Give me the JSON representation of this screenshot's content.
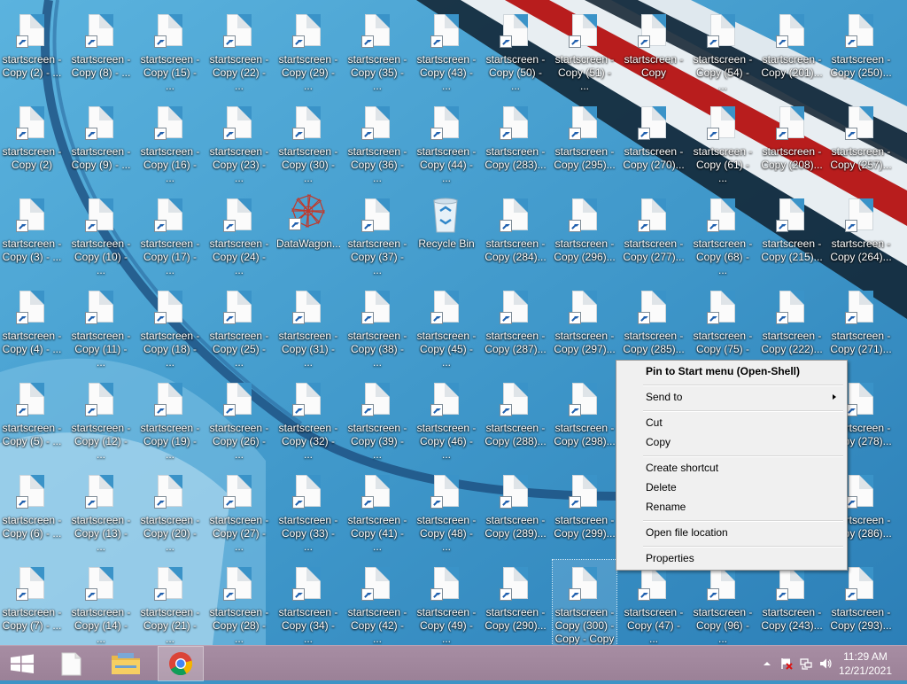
{
  "desktop": {
    "shortcut_label_prefix": "startscreen -",
    "columns": [
      [
        "Copy (2) - ...",
        "Copy (2)",
        "Copy (3) - ...",
        "Copy (4) - ...",
        "Copy (5) - ...",
        "Copy (6) - ...",
        "Copy (7) - ..."
      ],
      [
        "Copy (8) - ...",
        "Copy (9) - ...",
        "Copy (10) - ...",
        "Copy (11) - ...",
        "Copy (12) - ...",
        "Copy (13) - ...",
        "Copy (14) - ..."
      ],
      [
        "Copy (15) - ...",
        "Copy (16) - ...",
        "Copy (17) - ...",
        "Copy (18) - ...",
        "Copy (19) - ...",
        "Copy (20) - ...",
        "Copy (21) - ..."
      ],
      [
        "Copy (22) - ...",
        "Copy (23) - ...",
        "Copy (24) - ...",
        "Copy (25) - ...",
        "Copy (26) - ...",
        "Copy (27) - ...",
        "Copy (28) - ..."
      ],
      [
        "Copy (29) - ...",
        "Copy (30) - ...",
        "DataWagon...",
        "Copy (31) - ...",
        "Copy (32) - ...",
        "Copy (33) - ...",
        "Copy (34) - ..."
      ],
      [
        "Copy (35) - ...",
        "Copy (36) - ...",
        "Copy (37) - ...",
        "Copy (38) - ...",
        "Copy (39) - ...",
        "Copy (41) - ...",
        "Copy (42) - ..."
      ],
      [
        "Copy (43) - ...",
        "Copy (44) - ...",
        "Recycle Bin",
        "Copy (45) - ...",
        "Copy (46) - ...",
        "Copy (48) - ...",
        "Copy (49) - ..."
      ],
      [
        "Copy (50) - ...",
        "Copy (283)...",
        "Copy (284)...",
        "Copy (287)...",
        "Copy (288)...",
        "Copy (289)...",
        "Copy (290)..."
      ],
      [
        "Copy (51) - ...",
        "Copy (295)...",
        "Copy (296)...",
        "Copy (297)...",
        "Copy (298)...",
        "Copy (299)...",
        "Copy (300) - Copy - Copy"
      ],
      [
        "Copy",
        "Copy (270)...",
        "Copy (277)...",
        "Copy (285)...",
        "",
        "",
        "Copy (47) - ..."
      ],
      [
        "Copy (54) - ...",
        "Copy (61) - ...",
        "Copy (68) - ...",
        "Copy (75) - ...",
        "",
        "",
        "Copy (96) - ..."
      ],
      [
        "Copy (201)...",
        "Copy (208)...",
        "Copy (215)...",
        "Copy (222)...",
        "",
        "",
        "Copy (243)..."
      ],
      [
        "Copy (250)...",
        "Copy (257)...",
        "Copy (264)...",
        "Copy (271)...",
        "Copy (278)...",
        "Copy (286)...",
        "Copy (293)..."
      ]
    ],
    "selected_icon": "Copy (300) - Copy - Copy"
  },
  "context_menu": {
    "items": [
      {
        "label": "Pin to Start menu (Open-Shell)",
        "bold": true
      },
      {
        "label": "Send to",
        "submenu": true
      },
      {
        "label": "Cut"
      },
      {
        "label": "Copy"
      },
      {
        "label": "Create shortcut"
      },
      {
        "label": "Delete"
      },
      {
        "label": "Rename"
      },
      {
        "label": "Open file location"
      },
      {
        "label": "Properties"
      }
    ]
  },
  "taskbar": {
    "buttons": [
      {
        "name": "start-button",
        "icon": "windows-logo-icon"
      },
      {
        "name": "taskbar-file-button",
        "icon": "blank-file-icon"
      },
      {
        "name": "taskbar-explorer-button",
        "icon": "folder-icon"
      },
      {
        "name": "taskbar-chrome-button",
        "icon": "chrome-icon",
        "active": true
      }
    ],
    "tray": {
      "icons": [
        "chevron-up-icon",
        "action-center-flag-icon",
        "network-icon",
        "volume-icon"
      ],
      "time": "11:29 AM",
      "date": "12/21/2021"
    }
  },
  "colors": {
    "taskbar": "#9b8197",
    "desktop": "#3a93c8",
    "menu_bg": "#f0f0f0"
  }
}
